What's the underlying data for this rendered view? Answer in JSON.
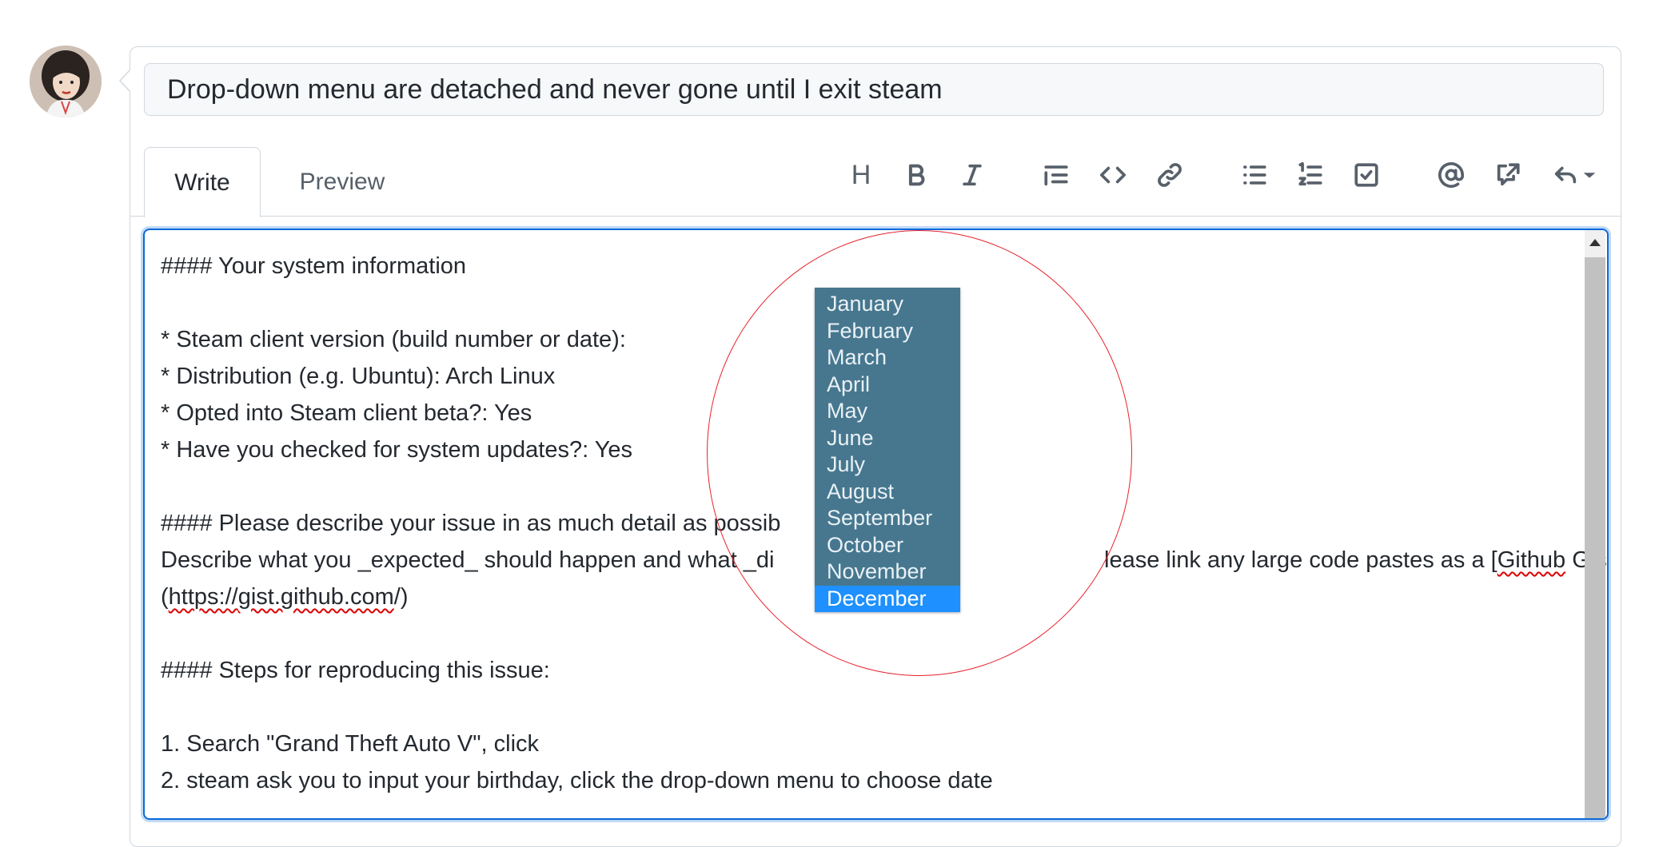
{
  "avatar": {
    "alt": "user avatar"
  },
  "title": {
    "value": "Drop-down menu are detached and never gone until I exit steam"
  },
  "tabs": {
    "write": "Write",
    "preview": "Preview"
  },
  "toolbar": {
    "heading": "H",
    "icons": [
      "heading-icon",
      "bold-icon",
      "italic-icon",
      "quote-icon",
      "code-icon",
      "link-icon",
      "unordered-list-icon",
      "ordered-list-icon",
      "task-list-icon",
      "mention-icon",
      "reference-icon",
      "reply-icon"
    ]
  },
  "editor": {
    "lines": [
      "#### Your system information",
      "",
      "* Steam client version (build number or date):",
      "* Distribution (e.g. Ubuntu): Arch Linux",
      "* Opted into Steam client beta?: Yes",
      "* Have you checked for system updates?: Yes",
      "",
      "#### Please describe your issue in as much detail as possib",
      "Describe what you _expected_ should happen and what _di",
      "(",
      "",
      "#### Steps for reproducing this issue:",
      "",
      "1. Search \"Grand Theft Auto V\", click",
      "2. steam ask you to input your birthday, click the drop-down menu to choose date"
    ],
    "line9_rest_a": "lease link any large code pastes as a [",
    "line9_github": "Github",
    "line9_rest_b": " Gist]",
    "line10_link_a": "https://",
    "line10_gist": "gist.github.com",
    "line10_link_b": "/)"
  },
  "dropdown": {
    "options": [
      "January",
      "February",
      "March",
      "April",
      "May",
      "June",
      "July",
      "August",
      "September",
      "October",
      "November",
      "December"
    ],
    "selected": "December"
  },
  "colors": {
    "accent": "#0969da",
    "dropdown_bg": "#46778f",
    "dropdown_selected": "#1e90ff",
    "annotation_circle": "#e8202a"
  }
}
